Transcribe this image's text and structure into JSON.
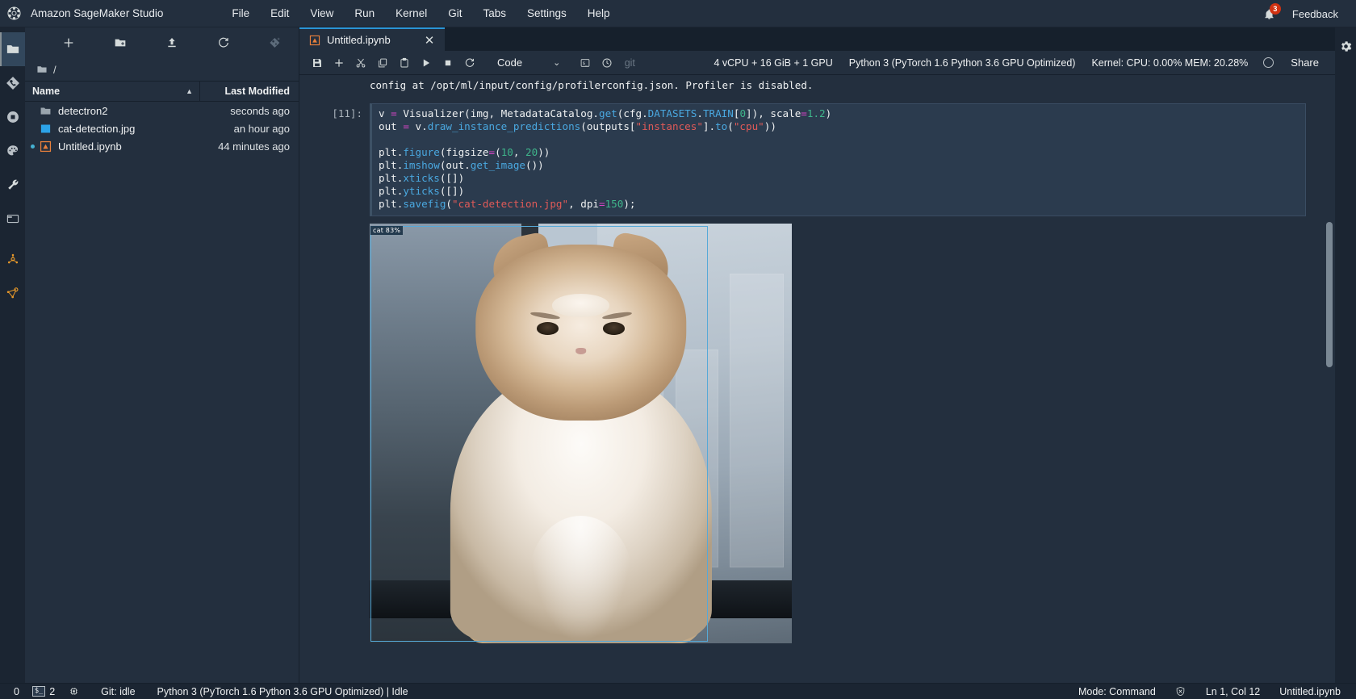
{
  "app": {
    "title": "Amazon SageMaker Studio",
    "logo_icon": "sagemaker-logo-icon"
  },
  "menubar": {
    "items": [
      {
        "label": "File",
        "name": "menu-file"
      },
      {
        "label": "Edit",
        "name": "menu-edit"
      },
      {
        "label": "View",
        "name": "menu-view"
      },
      {
        "label": "Run",
        "name": "menu-run"
      },
      {
        "label": "Kernel",
        "name": "menu-kernel"
      },
      {
        "label": "Git",
        "name": "menu-git"
      },
      {
        "label": "Tabs",
        "name": "menu-tabs"
      },
      {
        "label": "Settings",
        "name": "menu-settings"
      },
      {
        "label": "Help",
        "name": "menu-help"
      }
    ],
    "notification_icon": "bell-icon",
    "notification_count": "3",
    "feedback_label": "Feedback"
  },
  "activitybar": {
    "items": [
      {
        "name": "sidebar-item-file-browser",
        "icon": "folder-icon",
        "active": true
      },
      {
        "name": "sidebar-item-git",
        "icon": "git-icon",
        "active": false
      },
      {
        "name": "sidebar-item-running-terminals",
        "icon": "stop-circle-icon",
        "active": false
      },
      {
        "name": "sidebar-item-themes",
        "icon": "palette-icon",
        "active": false
      },
      {
        "name": "sidebar-item-tools",
        "icon": "wrench-icon",
        "active": false
      },
      {
        "name": "sidebar-item-open-tabs",
        "icon": "window-icon",
        "active": false
      },
      {
        "name": "sidebar-item-experiments",
        "icon": "experiment-node-icon",
        "active": false
      },
      {
        "name": "sidebar-item-pipelines",
        "icon": "pipeline-graph-icon",
        "active": false
      }
    ]
  },
  "filebrowser": {
    "toolbar": [
      {
        "name": "new-launcher-button",
        "icon": "plus-icon"
      },
      {
        "name": "new-folder-button",
        "icon": "folder-plus-icon"
      },
      {
        "name": "upload-files-button",
        "icon": "upload-icon"
      },
      {
        "name": "refresh-file-list-button",
        "icon": "refresh-icon"
      },
      {
        "name": "git-clone-button",
        "icon": "git-clone-icon"
      }
    ],
    "breadcrumb": "/",
    "columns": {
      "name": "Name",
      "last_modified": "Last Modified",
      "sort_indicator": "▲"
    },
    "rows": [
      {
        "name": "detectron2",
        "modified": "seconds ago",
        "icon": "folder-icon",
        "running": false
      },
      {
        "name": "cat-detection.jpg",
        "modified": "an hour ago",
        "icon": "image-file-icon",
        "running": false
      },
      {
        "name": "Untitled.ipynb",
        "modified": "44 minutes ago",
        "icon": "notebook-file-icon",
        "running": true
      }
    ]
  },
  "notebook": {
    "tab": {
      "label": "Untitled.ipynb",
      "icon": "notebook-file-icon",
      "close_icon": "close-icon"
    },
    "toolbar": {
      "buttons": [
        {
          "name": "save-notebook-button",
          "icon": "save-icon"
        },
        {
          "name": "insert-cell-button",
          "icon": "plus-icon"
        },
        {
          "name": "cut-cell-button",
          "icon": "scissors-icon"
        },
        {
          "name": "copy-cell-button",
          "icon": "copy-icon"
        },
        {
          "name": "paste-cell-button",
          "icon": "paste-icon"
        },
        {
          "name": "run-cell-button",
          "icon": "play-icon"
        },
        {
          "name": "interrupt-kernel-button",
          "icon": "stop-icon"
        },
        {
          "name": "restart-kernel-button",
          "icon": "restart-icon"
        }
      ],
      "cell_type": "Code",
      "cell_type_chevron": "⌄",
      "terminal_icon": "terminal-icon",
      "history_icon": "clock-icon",
      "git_label": "git",
      "instance_label": "4 vCPU + 16 GiB + 1 GPU",
      "kernel_label": "Python 3 (PyTorch 1.6 Python 3.6 GPU Optimized)",
      "resource_label": "Kernel: CPU: 0.00% MEM: 20.28%",
      "kernel_status_icon": "kernel-idle-circle-icon",
      "share_label": "Share"
    },
    "previous_output": "config at /opt/ml/input/config/profilerconfig.json. Profiler is disabled.",
    "cell": {
      "prompt": "[11]:",
      "lines": [
        "v = Visualizer(img, MetadataCatalog.get(cfg.DATASETS.TRAIN[0]), scale=1.2)",
        "out = v.draw_instance_predictions(outputs[\"instances\"].to(\"cpu\"))",
        "",
        "plt.figure(figsize=(10, 20))",
        "plt.imshow(out.get_image())",
        "plt.xticks([])",
        "plt.yticks([])",
        "plt.savefig(\"cat-detection.jpg\", dpi=150);"
      ]
    },
    "output_image": {
      "detection_label": "cat 83%",
      "box_color": "#56a9d8",
      "alt": "Detected cat sitting on window sill with bounding box"
    }
  },
  "rightbar": {
    "settings_icon": "gear-icon"
  },
  "statusbar": {
    "kernel_sessions": "0",
    "terminal_icon": "terminal-icon",
    "terminal_count": "2",
    "cpu_icon": "cpu-chip-icon",
    "git_status": "Git: idle",
    "kernel_status": "Python 3 (PyTorch 1.6 Python 3.6 GPU Optimized) | Idle",
    "mode": "Mode: Command",
    "trust_icon": "untrusted-shield-icon",
    "cursor_position": "Ln 1, Col 12",
    "filename": "Untitled.ipynb"
  },
  "colors": {
    "chrome": "#232f3e",
    "panel_dark": "#1b2532",
    "accent": "#2a95d6",
    "badge_red": "#d13212",
    "cell_bg": "#2b3b4e",
    "text": "#eff1f2",
    "orange_icon": "#e8992a"
  }
}
